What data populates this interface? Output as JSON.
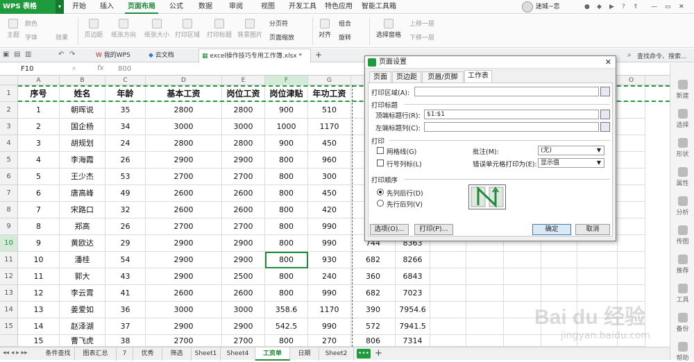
{
  "app": {
    "title": "WPS 表格",
    "menu_tabs": [
      "开始",
      "插入",
      "页面布局",
      "公式",
      "数据",
      "审阅",
      "视图",
      "开发工具",
      "特色应用",
      "智能工具箱"
    ],
    "active_tab": "页面布局",
    "user_name": "迷城~恋"
  },
  "ribbon": {
    "buttons": [
      "主题",
      "颜色",
      "字体",
      "效果",
      "页边距",
      "纸张方向",
      "纸张大小",
      "打印区域",
      "打印标题",
      "背景图片",
      "分页符",
      "页面缩放",
      "对齐",
      "组合",
      "旋转",
      "选择窗格",
      "上移一层",
      "下移一层"
    ]
  },
  "doc_tabs": [
    "我的WPS",
    "云文档",
    "excel操作技巧专用工作簿.xlsx *"
  ],
  "search_placeholder": "查找命令、搜索...",
  "formula_bar": {
    "cell_ref": "F10",
    "fx": "fx",
    "value": "800"
  },
  "columns": [
    "A",
    "B",
    "C",
    "D",
    "E",
    "F",
    "G"
  ],
  "extra_columns": [
    "O"
  ],
  "table": {
    "headers": [
      "序号",
      "姓名",
      "年龄",
      "基本工资",
      "岗位工资",
      "岗位津贴",
      "年功工资",
      "绩"
    ],
    "rows": [
      [
        "1",
        "朝晖说",
        "35",
        "2800",
        "2800",
        "900",
        "510"
      ],
      [
        "2",
        "国企杨",
        "34",
        "3000",
        "3000",
        "1000",
        "1170"
      ],
      [
        "3",
        "胡规划",
        "24",
        "2800",
        "2800",
        "900",
        "450"
      ],
      [
        "4",
        "李海霞",
        "26",
        "2900",
        "2900",
        "800",
        "960"
      ],
      [
        "5",
        "王少杰",
        "53",
        "2700",
        "2700",
        "800",
        "300"
      ],
      [
        "6",
        "唐高峰",
        "49",
        "2600",
        "2600",
        "800",
        "450"
      ],
      [
        "7",
        "宋路口",
        "32",
        "2600",
        "2600",
        "800",
        "420"
      ],
      [
        "8",
        "郑高",
        "26",
        "2700",
        "2700",
        "800",
        "990"
      ],
      [
        "9",
        "黄欧达",
        "29",
        "2900",
        "2900",
        "800",
        "990",
        "744",
        "8363"
      ],
      [
        "10",
        "潘桂",
        "54",
        "2900",
        "2900",
        "800",
        "930",
        "682",
        "8266"
      ],
      [
        "11",
        "郭大",
        "43",
        "2900",
        "2500",
        "800",
        "240",
        "360",
        "6843"
      ],
      [
        "12",
        "李云霄",
        "41",
        "2600",
        "2600",
        "800",
        "990",
        "682",
        "7023"
      ],
      [
        "13",
        "姜爱如",
        "36",
        "3000",
        "3000",
        "358.6",
        "1170",
        "390",
        "7954.6"
      ],
      [
        "14",
        "赵泽湖",
        "37",
        "2900",
        "2900",
        "542.5",
        "990",
        "572",
        "7941.5"
      ],
      [
        "15",
        "曹飞虎",
        "38",
        "2700",
        "2700",
        "800",
        "270",
        "806",
        "7314"
      ]
    ],
    "row_numbers": [
      "1",
      "2",
      "3",
      "4",
      "5",
      "6",
      "7",
      "8",
      "9",
      "10",
      "11",
      "12",
      "13",
      "14",
      "15"
    ]
  },
  "sheet_tabs": [
    "条件查找",
    "图表汇总",
    "7",
    "优秀",
    "筛选",
    "Sheet1",
    "Sheet4",
    "工资单",
    "日期",
    "Sheet2"
  ],
  "active_sheet": "工资单",
  "right_panel": [
    "新建",
    "选择",
    "形状",
    "属性",
    "分析",
    "传图",
    "推荐",
    "工具",
    "备份",
    "帮助"
  ],
  "dialog": {
    "title": "页面设置",
    "tabs": [
      "页面",
      "页边距",
      "页眉/页脚",
      "工作表"
    ],
    "active_tab": "工作表",
    "print_area_label": "打印区域(A):",
    "print_area_value": "",
    "print_titles_label": "打印标题",
    "top_rows_label": "顶端标题行(R):",
    "top_rows_value": "$1:$1",
    "left_cols_label": "左端标题列(C):",
    "left_cols_value": "",
    "print_label": "打印",
    "gridlines_label": "网格线(G)",
    "row_col_headers_label": "行号列标(L)",
    "comments_label": "批注(M):",
    "comments_value": "(无)",
    "errors_label": "错误单元格打印为(E):",
    "errors_value": "显示值",
    "order_label": "打印顺序",
    "down_then_over": "先列后行(D)",
    "over_then_down": "先行后列(V)",
    "options_button": "选项(O)...",
    "print_button": "打印(P)...",
    "ok_button": "确定",
    "cancel_button": "取消"
  },
  "watermark": {
    "brand": "Bai du 经验",
    "url": "jingyan.baidu.com"
  },
  "colors": {
    "accent": "#1e8a3a",
    "logo_bg": "#1e9b3c"
  }
}
